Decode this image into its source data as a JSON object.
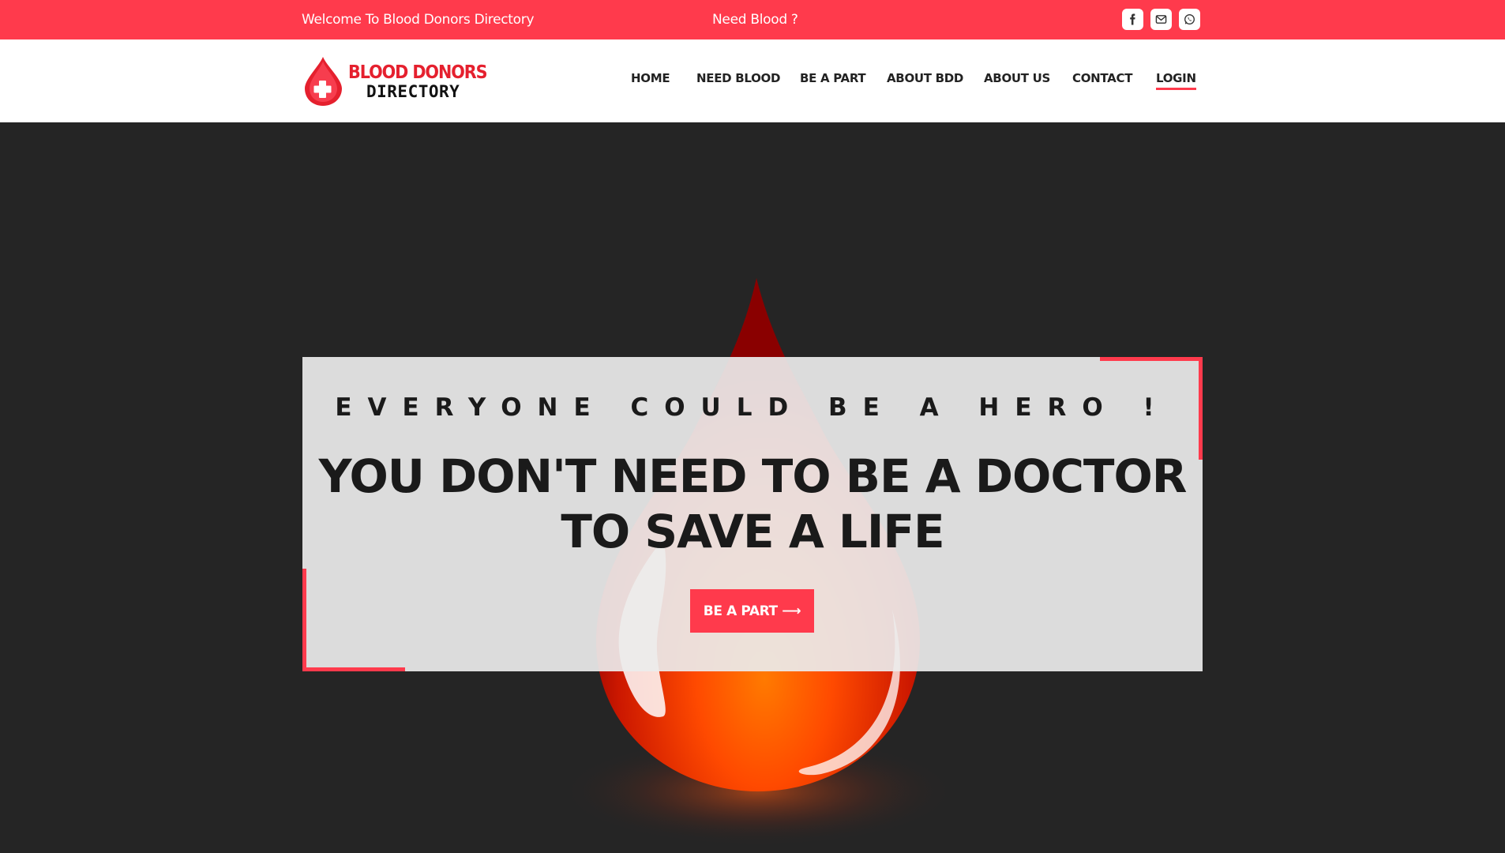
{
  "topbar": {
    "welcome_text": "Welcome To Blood Donors Directory",
    "need_blood_text": "Need Blood ?",
    "social": [
      "facebook-icon",
      "mail-icon",
      "whatsapp-icon"
    ]
  },
  "brand": {
    "line1": "BLOOD DONORS",
    "line2": "DIRECTORY"
  },
  "nav": {
    "items": [
      "HOME",
      "NEED BLOOD",
      "BE A PART",
      "ABOUT BDD",
      "ABOUT US",
      "CONTACT",
      "LOGIN"
    ],
    "active": "LOGIN"
  },
  "hero": {
    "tagline": "EVERYONE COULD BE A HERO !",
    "headline_line1": "YOU DON'T NEED TO BE A DOCTOR",
    "headline_line2": "TO SAVE A LIFE",
    "cta_label": "BE A PART ⟶"
  },
  "colors": {
    "accent": "#ff3a4c",
    "background": "#252525",
    "card": "#ebebeb"
  }
}
